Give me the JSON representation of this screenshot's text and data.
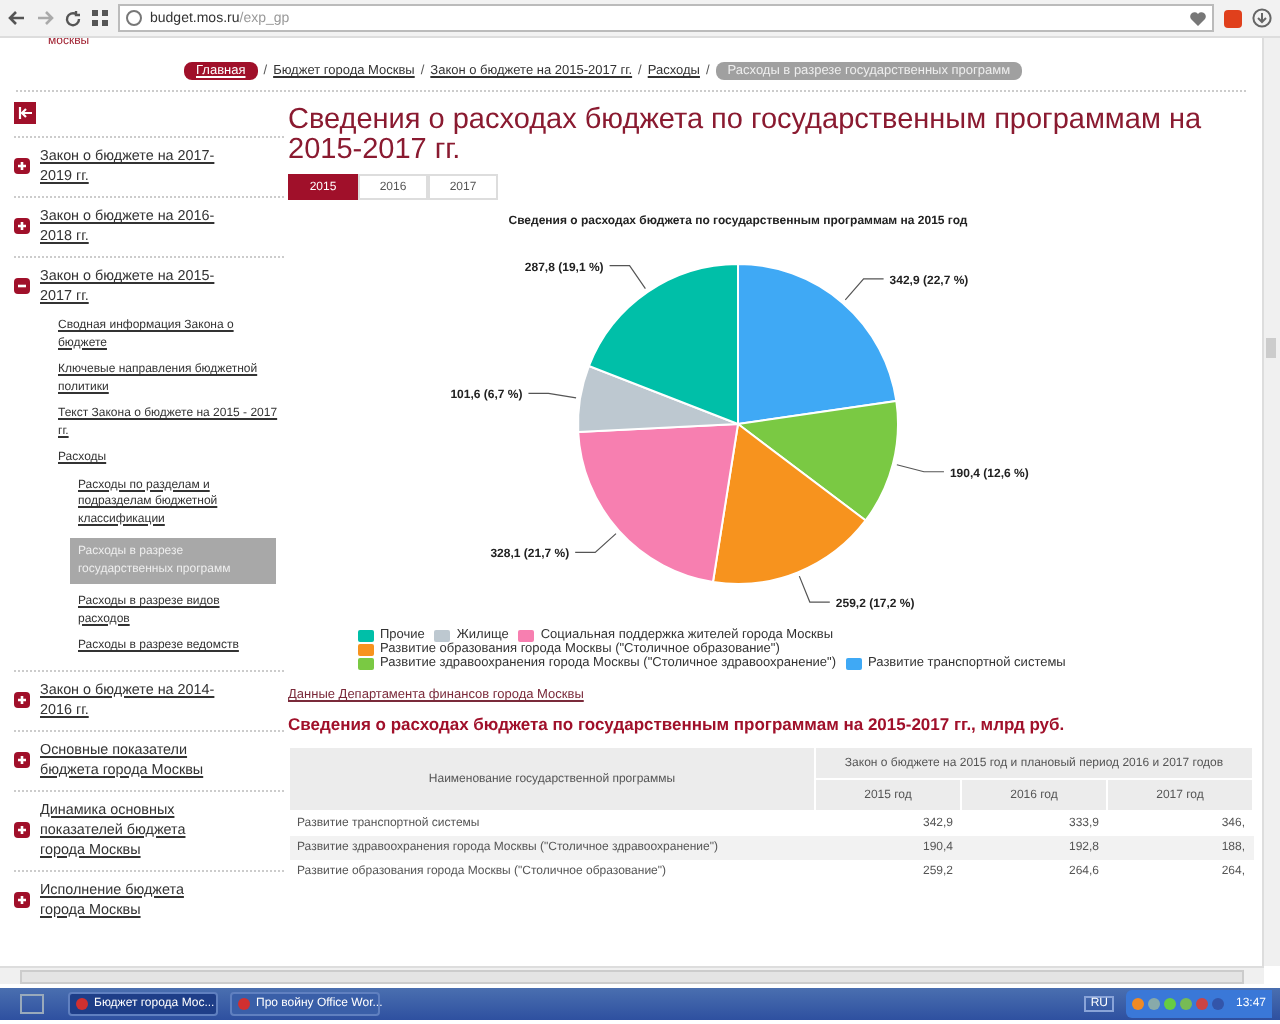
{
  "browser": {
    "url_host": "budget.mos.ru",
    "url_path": "/exp_gp"
  },
  "header_fragment": "москвы",
  "breadcrumbs": {
    "separator": "/",
    "items": [
      {
        "label": "Главная",
        "kind": "home"
      },
      {
        "label": "Бюджет города Москвы",
        "kind": "link"
      },
      {
        "label": "Закон о бюджете на 2015-2017 гг.",
        "kind": "link"
      },
      {
        "label": "Расходы",
        "kind": "link"
      },
      {
        "label": "Расходы в разрезе государственных программ",
        "kind": "current"
      }
    ]
  },
  "sidebar": {
    "items": [
      {
        "label": "Закон о бюджете на 2017-2019 гг.",
        "expanded": false
      },
      {
        "label": "Закон о бюджете на 2016-2018 гг.",
        "expanded": false
      },
      {
        "label": "Закон о бюджете на 2015-2017 гг.",
        "expanded": true,
        "children": [
          {
            "label": "Сводная информация Закона о бюджете",
            "selected": false
          },
          {
            "label": "Ключевые направления бюджетной политики",
            "selected": false
          },
          {
            "label": "Текст Закона о бюджете на 2015 - 2017 гг.",
            "selected": false
          },
          {
            "label": "Расходы",
            "selected": false,
            "children": [
              {
                "label": "Расходы по разделам и подразделам бюджетной классификации",
                "selected": false
              },
              {
                "label": "Расходы в разрезе государственных программ",
                "selected": true
              },
              {
                "label": "Расходы в разрезе видов расходов",
                "selected": false
              },
              {
                "label": "Расходы в разрезе ведомств",
                "selected": false
              }
            ]
          }
        ]
      },
      {
        "label": "Закон о бюджете на 2014-2016 гг.",
        "expanded": false
      },
      {
        "label": "Основные показатели бюджета города Москвы",
        "expanded": false
      },
      {
        "label": "Динамика основных показателей бюджета города Москвы",
        "expanded": false
      },
      {
        "label": "Исполнение бюджета города Москвы",
        "expanded": false
      }
    ]
  },
  "title": "Сведения о расходах бюджета по государственным программам на 2015-2017 гг.",
  "year_tabs": [
    {
      "label": "2015",
      "selected": true
    },
    {
      "label": "2016",
      "selected": false
    },
    {
      "label": "2017",
      "selected": false
    }
  ],
  "chart_data": {
    "type": "pie",
    "title": "Сведения о расходах бюджета по государственным программам на 2015 год",
    "categories": [
      "Развитие транспортной системы",
      "Развитие здравоохранения города Москвы (\"Столичное здравоохранение\")",
      "Развитие образования города Москвы (\"Столичное образование\")",
      "Социальная поддержка жителей города Москвы",
      "Жилище",
      "Прочие"
    ],
    "series": [
      {
        "colors": [
          "#3fa9f5",
          "#7ac943",
          "#f7931e",
          "#f77fb0",
          "#bdc8d0",
          "#00bfa8"
        ],
        "values": [
          22.7,
          12.6,
          17.2,
          21.7,
          6.7,
          19.1
        ]
      }
    ],
    "value_labels": [
      "342,9 (22,7 %)",
      "190,4 (12,6 %)",
      "259,2 (17,2 %)",
      "328,1 (21,7 %)",
      "101,6 (6,7 %)",
      "287,8 (19,1 %)"
    ]
  },
  "source_link": "Данные Департамента финансов города Москвы",
  "table_title": "Сведения о расходах бюджета по государственным программам на 2015-2017 гг., млрд руб.",
  "table": {
    "name_header": "Наименование государственной программы",
    "group_header": "Закон о бюджете на 2015 год и плановый период 2016 и 2017 годов",
    "columns": [
      "2015 год",
      "2016 год",
      "2017 год"
    ],
    "rows": [
      {
        "name": "Развитие транспортной системы",
        "values": [
          "342,9",
          "333,9",
          "346,"
        ]
      },
      {
        "name": "Развитие здравоохранения города Москвы (\"Столичное здравоохранение\")",
        "values": [
          "190,4",
          "192,8",
          "188,"
        ]
      },
      {
        "name": "Развитие образования города Москвы (\"Столичное образование\")",
        "values": [
          "259,2",
          "264,6",
          "264,"
        ]
      }
    ]
  },
  "taskbar": {
    "tasks": [
      {
        "label": "Бюджет города Мос...",
        "selected": true
      },
      {
        "label": "Про войну Office Wor...",
        "selected": false
      }
    ],
    "language": "RU",
    "clock": "13:47"
  }
}
